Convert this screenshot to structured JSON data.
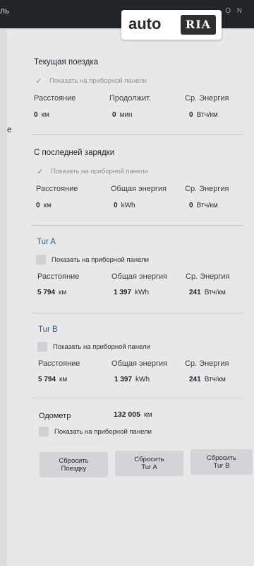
{
  "topbar": {
    "back_text": "ль",
    "status_icons": "O  N"
  },
  "edge_label": "е",
  "watermark": {
    "auto": "auto",
    "ria": "RIA"
  },
  "current_trip": {
    "title": "Текущая поездка",
    "show_label": "Показать на приборной панели",
    "checked": true,
    "col1_label": "Расстояние",
    "col2_label": "Продолжит.",
    "col3_label": "Ср. Энергия",
    "col1_value": "0",
    "col1_unit": "км",
    "col2_value": "0",
    "col2_unit": "мин",
    "col3_value": "0",
    "col3_unit": "Втч/км"
  },
  "since_charge": {
    "title": "С последней зарядки",
    "show_label": "Показать на приборной панели",
    "checked": true,
    "col1_label": "Расстояние",
    "col2_label": "Общая энергия",
    "col3_label": "Ср. Энергия",
    "col1_value": "0",
    "col1_unit": "км",
    "col2_value": "0",
    "col2_unit": "kWh",
    "col3_value": "0",
    "col3_unit": "Втч/км"
  },
  "trip_a": {
    "title": "Tur A",
    "show_label": "Показать на приборной панели",
    "checked": false,
    "col1_label": "Расстояние",
    "col2_label": "Общая энергия",
    "col3_label": "Ср. Энергия",
    "col1_value": "5 794",
    "col1_unit": "км",
    "col2_value": "1 397",
    "col2_unit": "kWh",
    "col3_value": "241",
    "col3_unit": "Втч/км"
  },
  "trip_b": {
    "title": "Tur B",
    "show_label": "Показать на приборной панели",
    "checked": false,
    "col1_label": "Расстояние",
    "col2_label": "Общая энергия",
    "col3_label": "Ср. Энергия",
    "col1_value": "5 794",
    "col1_unit": "км",
    "col2_value": "1 397",
    "col2_unit": "kWh",
    "col3_value": "241",
    "col3_unit": "Втч/км"
  },
  "odometer": {
    "label": "Одометр",
    "value": "132 005",
    "unit": "км",
    "show_label": "Показать на приборной панели",
    "checked": false
  },
  "buttons": {
    "reset_trip_1": "Сбросить",
    "reset_trip_2": "Поездку",
    "reset_a_1": "Сбросить",
    "reset_a_2": "Tur A",
    "reset_b_1": "Сбросить",
    "reset_b_2": "Tur B"
  }
}
